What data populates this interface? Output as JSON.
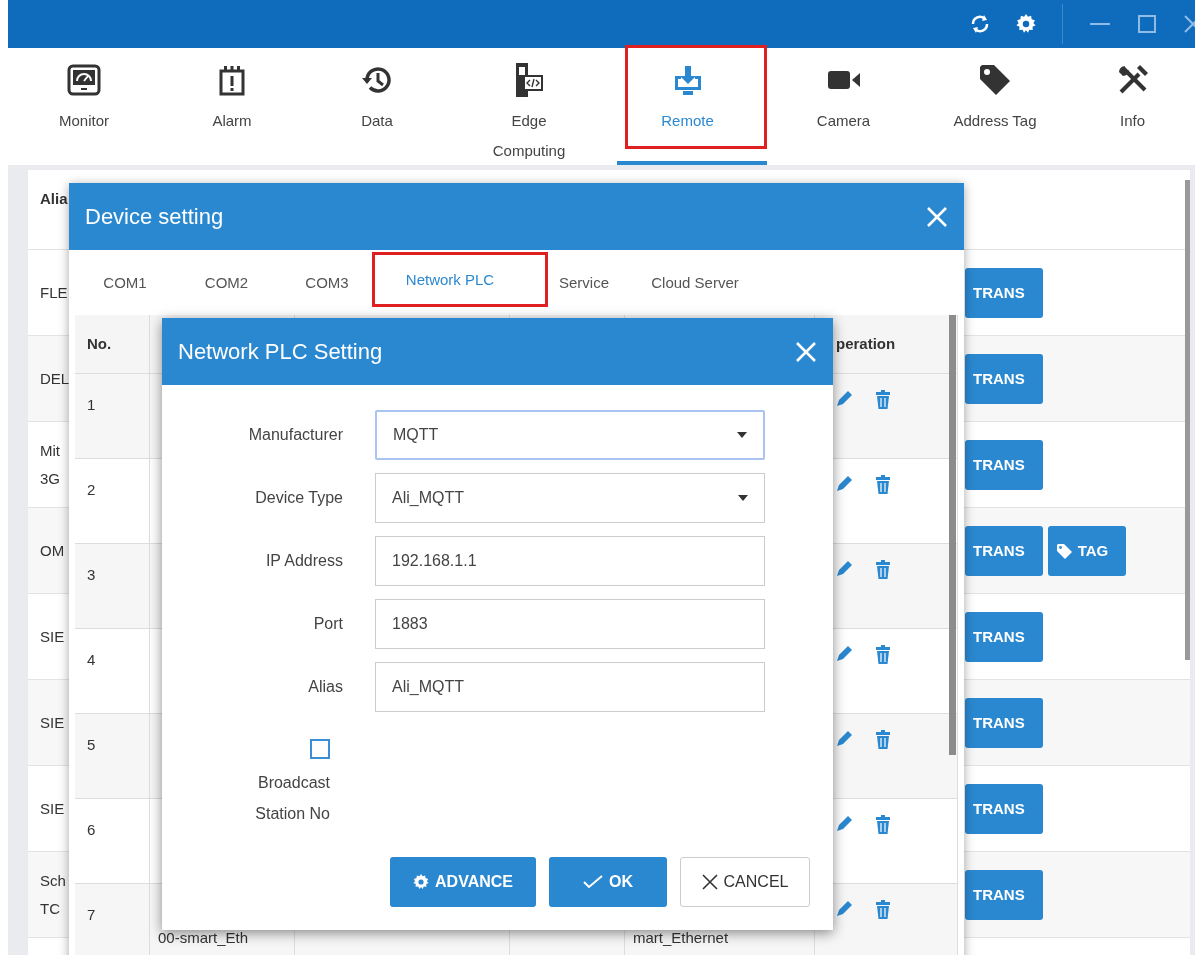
{
  "toolbar": [
    {
      "label": "Monitor",
      "kind": "gauge",
      "selected": false,
      "annotated": false
    },
    {
      "label": "Alarm",
      "kind": "alarm",
      "selected": false,
      "annotated": false
    },
    {
      "label": "Data",
      "kind": "history",
      "selected": false,
      "annotated": false
    },
    {
      "label": "Edge Computing",
      "kind": "code",
      "selected": false,
      "annotated": false
    },
    {
      "label": "Remote",
      "kind": "download",
      "selected": true,
      "annotated": true
    },
    {
      "label": "Camera",
      "kind": "camera",
      "selected": false,
      "annotated": false
    },
    {
      "label": "Address Tag",
      "kind": "tag",
      "selected": false,
      "annotated": false
    },
    {
      "label": "Info",
      "kind": "tools",
      "selected": false,
      "annotated": false
    }
  ],
  "main_table": {
    "column_1_header": "Alia",
    "rows": [
      {
        "lines": [
          "FLE"
        ],
        "buttons": [
          {
            "label": "TRANS"
          }
        ]
      },
      {
        "lines": [
          "DEL"
        ],
        "buttons": [
          {
            "label": "TRANS"
          }
        ]
      },
      {
        "lines": [
          "Mit",
          "3G"
        ],
        "buttons": [
          {
            "label": "TRANS"
          }
        ]
      },
      {
        "lines": [
          "OM"
        ],
        "buttons": [
          {
            "label": "TRANS"
          },
          {
            "label": "TAG",
            "kind": "tag"
          }
        ]
      },
      {
        "lines": [
          "SIE"
        ],
        "buttons": [
          {
            "label": "TRANS"
          }
        ]
      },
      {
        "lines": [
          "SIE"
        ],
        "buttons": [
          {
            "label": "TRANS"
          }
        ]
      },
      {
        "lines": [
          "SIE"
        ],
        "buttons": [
          {
            "label": "TRANS"
          }
        ]
      },
      {
        "lines": [
          "Sch",
          "TC"
        ],
        "buttons": [
          {
            "label": "TRANS"
          }
        ]
      }
    ]
  },
  "device_dialog": {
    "title": "Device setting",
    "tabs": [
      {
        "label": "COM1",
        "selected": false,
        "annotated": false
      },
      {
        "label": "COM2",
        "selected": false,
        "annotated": false
      },
      {
        "label": "COM3",
        "selected": false,
        "annotated": false
      },
      {
        "label": "Network PLC",
        "selected": true,
        "annotated": true
      },
      {
        "label": "Service",
        "selected": false,
        "annotated": false
      },
      {
        "label": "Cloud Server",
        "selected": false,
        "annotated": false
      }
    ],
    "table": {
      "no_header": "No.",
      "operation_header": "peration",
      "rows": [
        {
          "no": "1"
        },
        {
          "no": "2"
        },
        {
          "no": "3"
        },
        {
          "no": "4"
        },
        {
          "no": "5"
        },
        {
          "no": "6"
        },
        {
          "no": "7",
          "column_2": "00-smart_Eth",
          "column_5": "mart_Ethernet"
        }
      ]
    }
  },
  "plc_dialog": {
    "title": "Network PLC Setting",
    "fields": [
      {
        "kind": "select",
        "label": "Manufacturer",
        "value": "MQTT",
        "focused": true
      },
      {
        "kind": "select",
        "label": "Device Type",
        "value": "Ali_MQTT",
        "focused": false
      },
      {
        "kind": "text",
        "label": "IP Address",
        "value": "192.168.1.1",
        "focused": false
      },
      {
        "kind": "text",
        "label": "Port",
        "value": "1883",
        "focused": false
      },
      {
        "kind": "text",
        "label": "Alias",
        "value": "Ali_MQTT",
        "focused": false
      }
    ],
    "checkbox": {
      "label": "Broadcast Station No",
      "checked": false
    },
    "buttons": [
      {
        "kind": "primary",
        "label": "ADVANCE"
      },
      {
        "kind": "primary",
        "label": "OK"
      },
      {
        "kind": "secondary",
        "label": "CANCEL"
      }
    ]
  }
}
